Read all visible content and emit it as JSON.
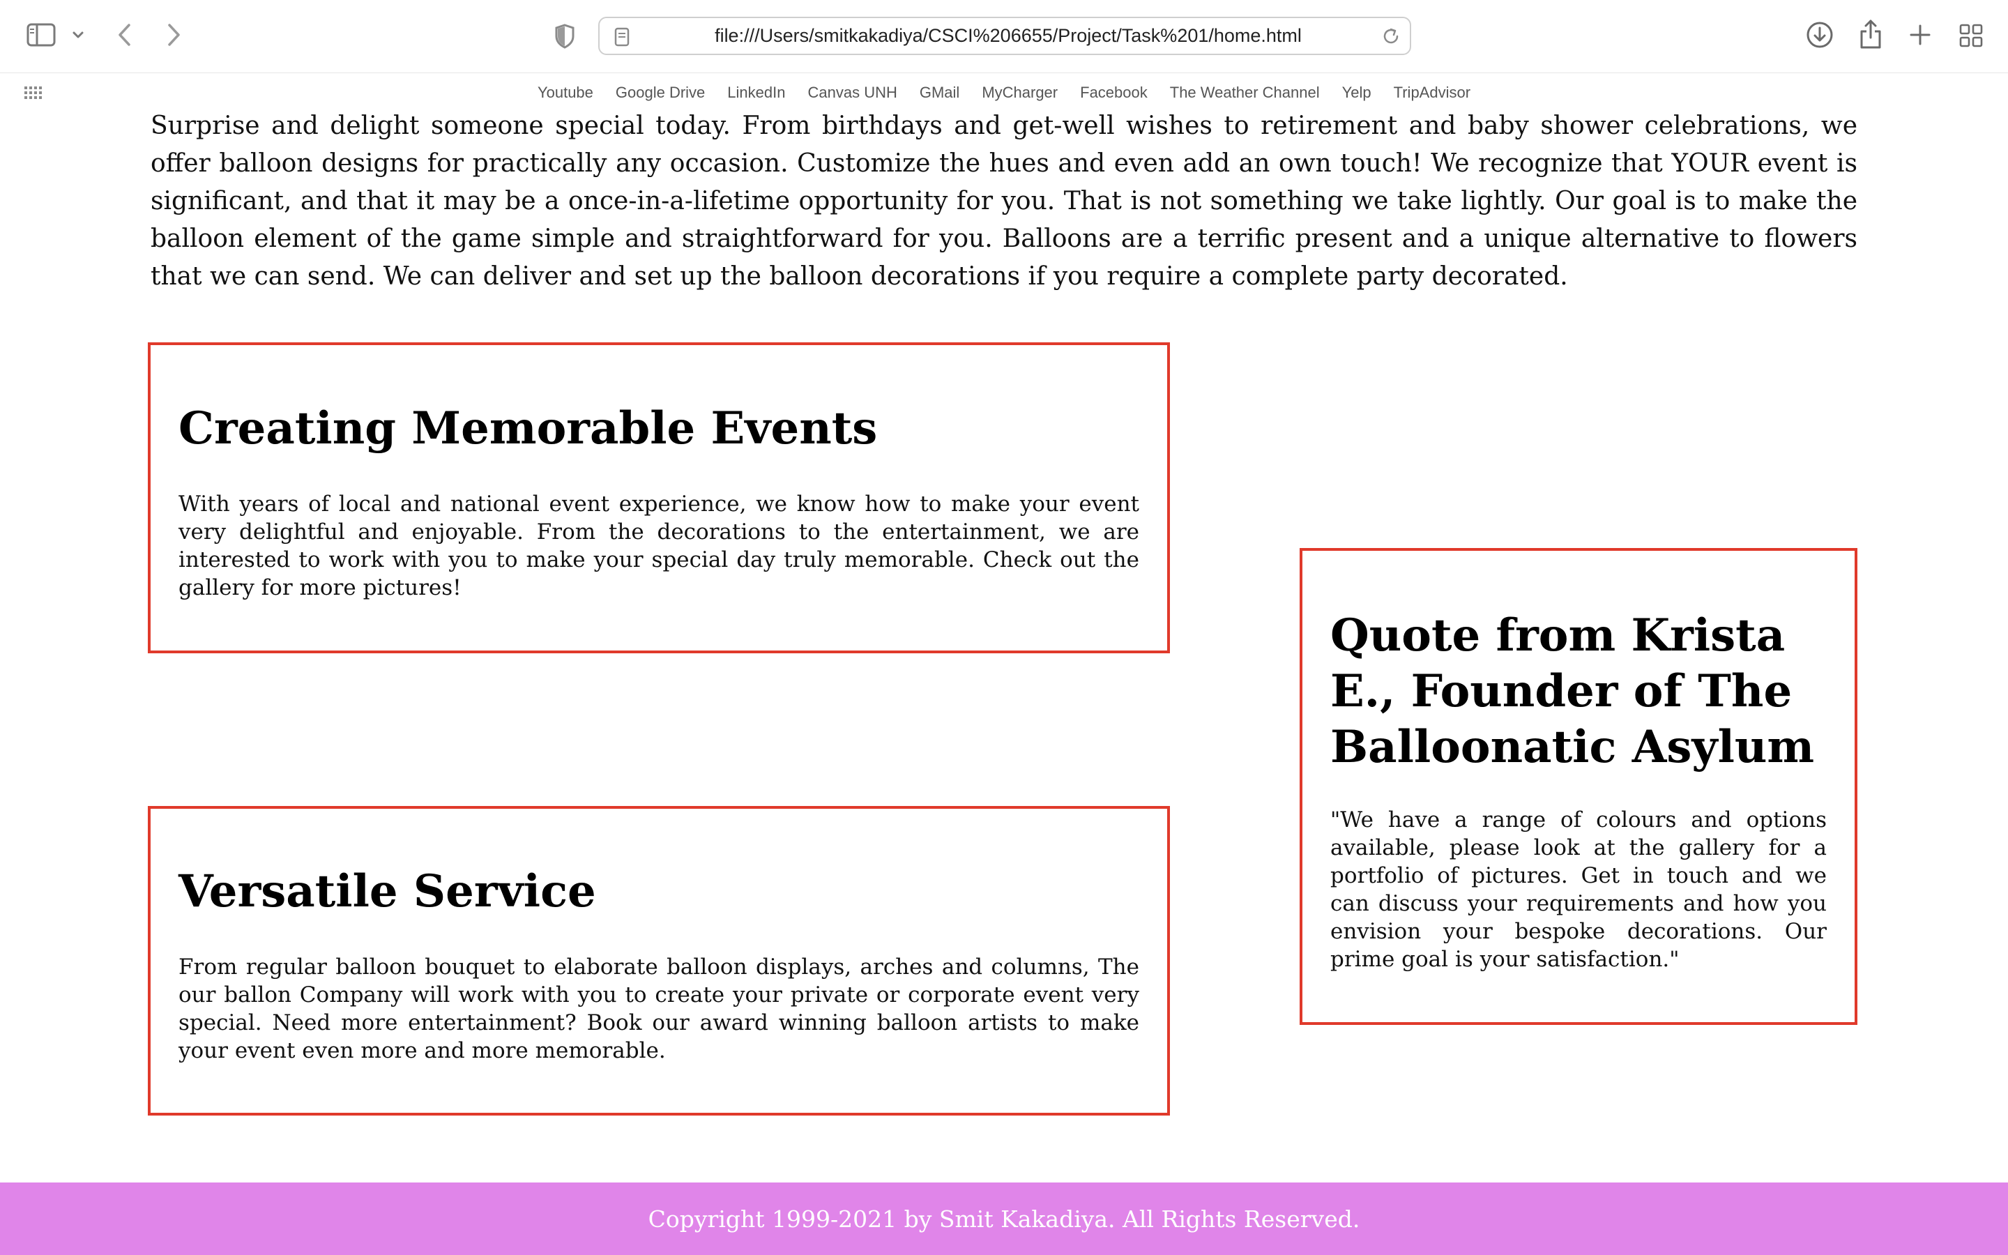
{
  "browser": {
    "url": "file:///Users/smitkakadiya/CSCI%206655/Project/Task%201/home.html",
    "favorites": [
      "Youtube",
      "Google Drive",
      "LinkedIn",
      "Canvas UNH",
      "GMail",
      "MyCharger",
      "Facebook",
      "The Weather Channel",
      "Yelp",
      "TripAdvisor"
    ],
    "icons": {
      "sidebar": "sidebar-icon",
      "sidebar_menu": "chevron-down-icon",
      "back": "chevron-left-icon",
      "forward": "chevron-right-icon",
      "privacy": "shield-icon",
      "page": "page-icon",
      "reload": "reload-icon",
      "downloads": "download-icon",
      "share": "share-icon",
      "new_tab": "plus-icon",
      "tab_overview": "tab-grid-icon",
      "favorites_grid": "grid-icon"
    }
  },
  "page": {
    "intro": "Surprise and delight someone special today. From birthdays and get-well wishes to retirement and baby shower celebrations, we offer balloon designs for practically any occasion. Customize the hues and even add an own touch! We recognize that YOUR event is significant, and that it may be a once-in-a-lifetime opportunity for you. That is not something we take lightly. Our goal is to make the balloon element of the game simple and straightforward for you. Balloons are a terrific present and a unique alternative to flowers that we can send. We can deliver and set up the balloon decorations if you require a complete party decorated.",
    "events": {
      "heading": "Creating Memorable Events",
      "body": "With years of local and national event experience, we know how to make your event very delightful and enjoyable. From the decorations to the entertainment, we are interested to work with you to make your special day truly memorable. Check out the gallery for more pictures!"
    },
    "service": {
      "heading": "Versatile Service",
      "body": "From regular balloon bouquet to elaborate balloon displays, arches and columns, The our ballon Company will work with you to create your private or corporate event very special. Need more entertainment? Book our award winning balloon artists to make your event even more and more memorable."
    },
    "quote": {
      "heading": "Quote from Krista E., Founder of The Balloonatic Asylum",
      "body": "\"We have a range of colours and options available, please look at the gallery for a portfolio of pictures. Get in touch and we can discuss your requirements and how you envision your bespoke decorations. Our prime goal is your satisfaction.\""
    },
    "footer": "Copyright 1999-2021 by Smit Kakadiya. All Rights Reserved."
  },
  "colors": {
    "box_border": "#e03a2b",
    "footer_bg": "#e085e9",
    "footer_text": "#ffffff"
  }
}
